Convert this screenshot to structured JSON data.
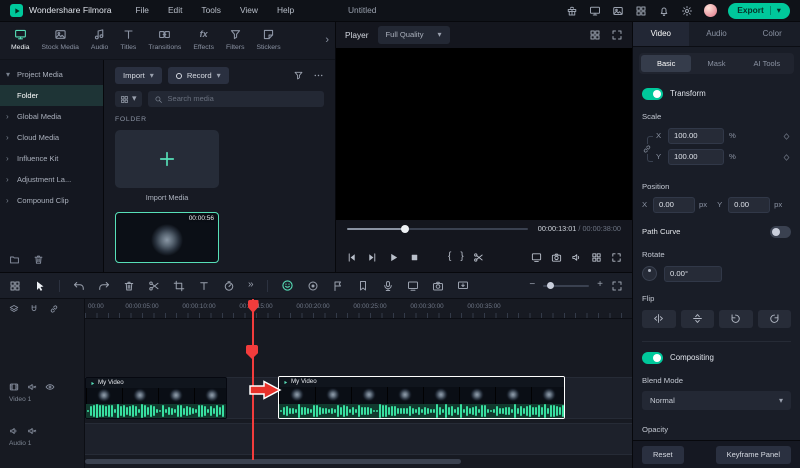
{
  "colors": {
    "accent": "#00c89b",
    "mint": "#57e0b8",
    "wave": "#38dfa0",
    "red": "#f23c3c",
    "annot": "#e8312a"
  },
  "glyphs": {
    "chevron_down": "▾",
    "chevron_right": "›",
    "more_tools": "»",
    "zoom_out": "−",
    "zoom_in": "+",
    "mark_in": "{",
    "mark_out": "}",
    "effects_fx": "fx"
  },
  "titlebar": {
    "app_name": "Wondershare Filmora",
    "menus": [
      "File",
      "Edit",
      "Tools",
      "View",
      "Help"
    ],
    "project_name": "Untitled",
    "export_label": "Export"
  },
  "media_panel": {
    "tabs": [
      {
        "label": "Media"
      },
      {
        "label": "Stock Media"
      },
      {
        "label": "Audio"
      },
      {
        "label": "Titles"
      },
      {
        "label": "Transitions"
      },
      {
        "label": "Effects"
      },
      {
        "label": "Filters"
      },
      {
        "label": "Stickers"
      }
    ],
    "sidebar_items": [
      {
        "label": "Project Media"
      },
      {
        "label": "Folder"
      },
      {
        "label": "Global Media"
      },
      {
        "label": "Cloud Media"
      },
      {
        "label": "Influence Kit"
      },
      {
        "label": "Adjustment La..."
      },
      {
        "label": "Compound Clip"
      }
    ],
    "import_button": "Import",
    "record_button": "Record",
    "search_placeholder": "Search media",
    "section_label": "FOLDER",
    "import_card_label": "Import Media",
    "clip_duration": "00:00:56"
  },
  "player": {
    "label": "Player",
    "quality": "Full Quality",
    "current_time": "00:00:13:01",
    "time_separator": "/",
    "total_time": "00:00:38:00"
  },
  "properties": {
    "tabs": [
      "Video",
      "Audio",
      "Color"
    ],
    "subtabs": [
      "Basic",
      "Mask",
      "AI Tools"
    ],
    "transform_label": "Transform",
    "scale_label": "Scale",
    "axis_x": "X",
    "axis_y": "Y",
    "scale_x_value": "100.00",
    "scale_y_value": "100.00",
    "percent_unit": "%",
    "position_label": "Position",
    "pos_x_value": "0.00",
    "pos_y_value": "0.00",
    "px_unit": "px",
    "path_curve_label": "Path Curve",
    "rotate_label": "Rotate",
    "rotate_value": "0.00°",
    "flip_label": "Flip",
    "compositing_label": "Compositing",
    "blend_mode_label": "Blend Mode",
    "blend_mode_value": "Normal",
    "opacity_label": "Opacity",
    "reset_button": "Reset",
    "keyframe_button": "Keyframe Panel"
  },
  "timeline": {
    "ruler_labels": [
      "00:00",
      "00:00:05:00",
      "00:00:10:00",
      "00:00:15:00",
      "00:00:20:00",
      "00:00:25:00",
      "00:00:30:00",
      "00:00:35:00"
    ],
    "clips": [
      {
        "name": "My Video",
        "selected": false
      },
      {
        "name": "My Video",
        "selected": true
      }
    ],
    "tracks": [
      {
        "label": "Video 1"
      },
      {
        "label": "Audio 1"
      }
    ]
  }
}
